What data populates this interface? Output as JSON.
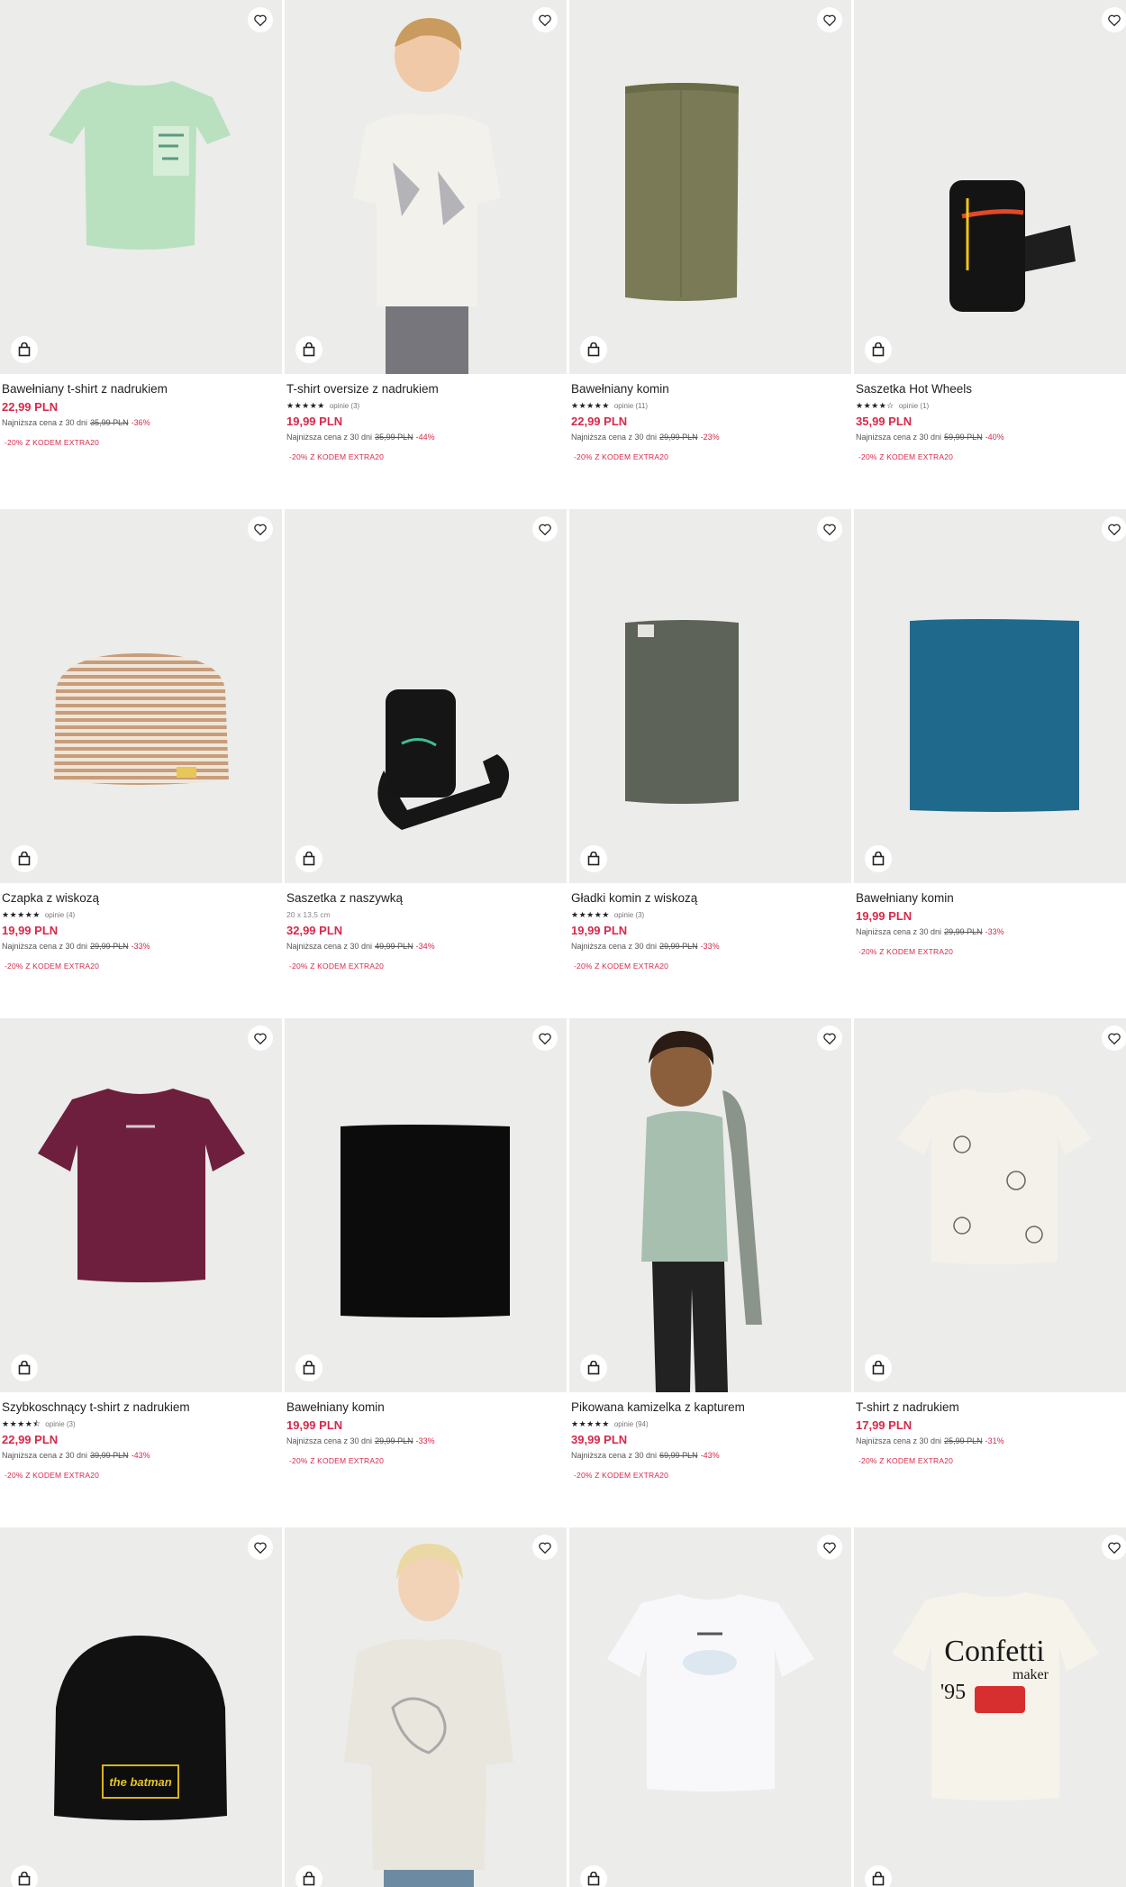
{
  "products": [
    {
      "name": "Bawełniany t-shirt z nadrukiem",
      "stars": "",
      "reviews": "",
      "dims": "",
      "price": "22,99 PLN",
      "lowest_label": "Najniższa cena z 30 dni",
      "old_price": "35,99 PLN",
      "discount": "-36%",
      "promo": "-20% Z KODEM EXTRA20"
    },
    {
      "name": "T-shirt oversize z nadrukiem",
      "stars": "★★★★★",
      "reviews": "opinie (3)",
      "dims": "",
      "price": "19,99 PLN",
      "lowest_label": "Najniższa cena z 30 dni",
      "old_price": "35,99 PLN",
      "discount": "-44%",
      "promo": "-20% Z KODEM EXTRA20"
    },
    {
      "name": "Bawełniany komin",
      "stars": "★★★★★",
      "reviews": "opinie (11)",
      "dims": "",
      "price": "22,99 PLN",
      "lowest_label": "Najniższa cena z 30 dni",
      "old_price": "29,99 PLN",
      "discount": "-23%",
      "promo": "-20% Z KODEM EXTRA20"
    },
    {
      "name": "Saszetka Hot Wheels",
      "stars": "★★★★☆",
      "reviews": "opinie (1)",
      "dims": "",
      "price": "35,99 PLN",
      "lowest_label": "Najniższa cena z 30 dni",
      "old_price": "59,99 PLN",
      "discount": "-40%",
      "promo": "-20% Z KODEM EXTRA20"
    },
    {
      "name": "Czapka z wiskozą",
      "stars": "★★★★★",
      "reviews": "opinie (4)",
      "dims": "",
      "price": "19,99 PLN",
      "lowest_label": "Najniższa cena z 30 dni",
      "old_price": "29,99 PLN",
      "discount": "-33%",
      "promo": "-20% Z KODEM EXTRA20"
    },
    {
      "name": "Saszetka z naszywką",
      "stars": "",
      "reviews": "",
      "dims": "20 x 13,5 cm",
      "price": "32,99 PLN",
      "lowest_label": "Najniższa cena z 30 dni",
      "old_price": "49,99 PLN",
      "discount": "-34%",
      "promo": "-20% Z KODEM EXTRA20"
    },
    {
      "name": "Gładki komin z wiskozą",
      "stars": "★★★★★",
      "reviews": "opinie (3)",
      "dims": "",
      "price": "19,99 PLN",
      "lowest_label": "Najniższa cena z 30 dni",
      "old_price": "29,99 PLN",
      "discount": "-33%",
      "promo": "-20% Z KODEM EXTRA20"
    },
    {
      "name": "Bawełniany komin",
      "stars": "",
      "reviews": "",
      "dims": "",
      "price": "19,99 PLN",
      "lowest_label": "Najniższa cena z 30 dni",
      "old_price": "29,99 PLN",
      "discount": "-33%",
      "promo": "-20% Z KODEM EXTRA20"
    },
    {
      "name": "Szybkoschnący t-shirt z nadrukiem",
      "stars": "★★★★⯪",
      "reviews": "opinie (3)",
      "dims": "",
      "price": "22,99 PLN",
      "lowest_label": "Najniższa cena z 30 dni",
      "old_price": "39,99 PLN",
      "discount": "-43%",
      "promo": "-20% Z KODEM EXTRA20"
    },
    {
      "name": "Bawełniany komin",
      "stars": "",
      "reviews": "",
      "dims": "",
      "price": "19,99 PLN",
      "lowest_label": "Najniższa cena z 30 dni",
      "old_price": "29,99 PLN",
      "discount": "-33%",
      "promo": "-20% Z KODEM EXTRA20"
    },
    {
      "name": "Pikowana kamizelka z kapturem",
      "stars": "★★★★★",
      "reviews": "opinie (94)",
      "dims": "",
      "price": "39,99 PLN",
      "lowest_label": "Najniższa cena z 30 dni",
      "old_price": "69,99 PLN",
      "discount": "-43%",
      "promo": "-20% Z KODEM EXTRA20"
    },
    {
      "name": "T-shirt z nadrukiem",
      "stars": "",
      "reviews": "",
      "dims": "",
      "price": "17,99 PLN",
      "lowest_label": "Najniższa cena z 30 dni",
      "old_price": "25,99 PLN",
      "discount": "-31%",
      "promo": "-20% Z KODEM EXTRA20"
    },
    {
      "name": "",
      "stars": "",
      "reviews": "",
      "dims": "",
      "price": "",
      "lowest_label": "",
      "old_price": "",
      "discount": "",
      "promo": ""
    },
    {
      "name": "",
      "stars": "",
      "reviews": "",
      "dims": "",
      "price": "",
      "lowest_label": "",
      "old_price": "",
      "discount": "",
      "promo": ""
    },
    {
      "name": "",
      "stars": "",
      "reviews": "",
      "dims": "",
      "price": "",
      "lowest_label": "",
      "old_price": "",
      "discount": "",
      "promo": ""
    },
    {
      "name": "",
      "stars": "",
      "reviews": "",
      "dims": "",
      "price": "",
      "lowest_label": "",
      "old_price": "",
      "discount": "",
      "promo": ""
    }
  ],
  "artwork_text": {
    "beanie_patch": "the batman",
    "confetti_word": "Confetti",
    "confetti_sub": "maker",
    "confetti_year": "'95"
  },
  "colors": {
    "price_red": "#d6294a",
    "photo_bg": "#ececea"
  },
  "icons": {
    "wishlist": "heart-icon",
    "add_to_cart": "shopping-bag-icon"
  }
}
